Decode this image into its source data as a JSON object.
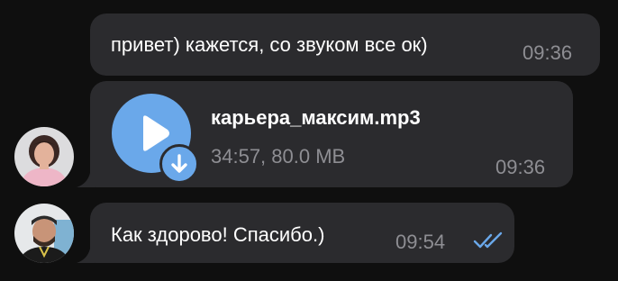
{
  "messages": [
    {
      "kind": "text",
      "text": "привет) кажется, со звуком все ок)",
      "time": "09:36"
    },
    {
      "kind": "file",
      "file_name": "карьера_максим.mp3",
      "file_meta": "34:57, 80.0 MB",
      "time": "09:36"
    },
    {
      "kind": "text",
      "text": "Как здорово! Спасибо.)",
      "time": "09:54",
      "status": "read"
    }
  ],
  "colors": {
    "background": "#0f0f0f",
    "bubble": "#2b2b2e",
    "accent": "#6aa8ea",
    "time": "#8e8e93"
  },
  "icons": {
    "play": "play-icon",
    "download": "download-arrow-icon",
    "read_status": "double-check-icon"
  }
}
